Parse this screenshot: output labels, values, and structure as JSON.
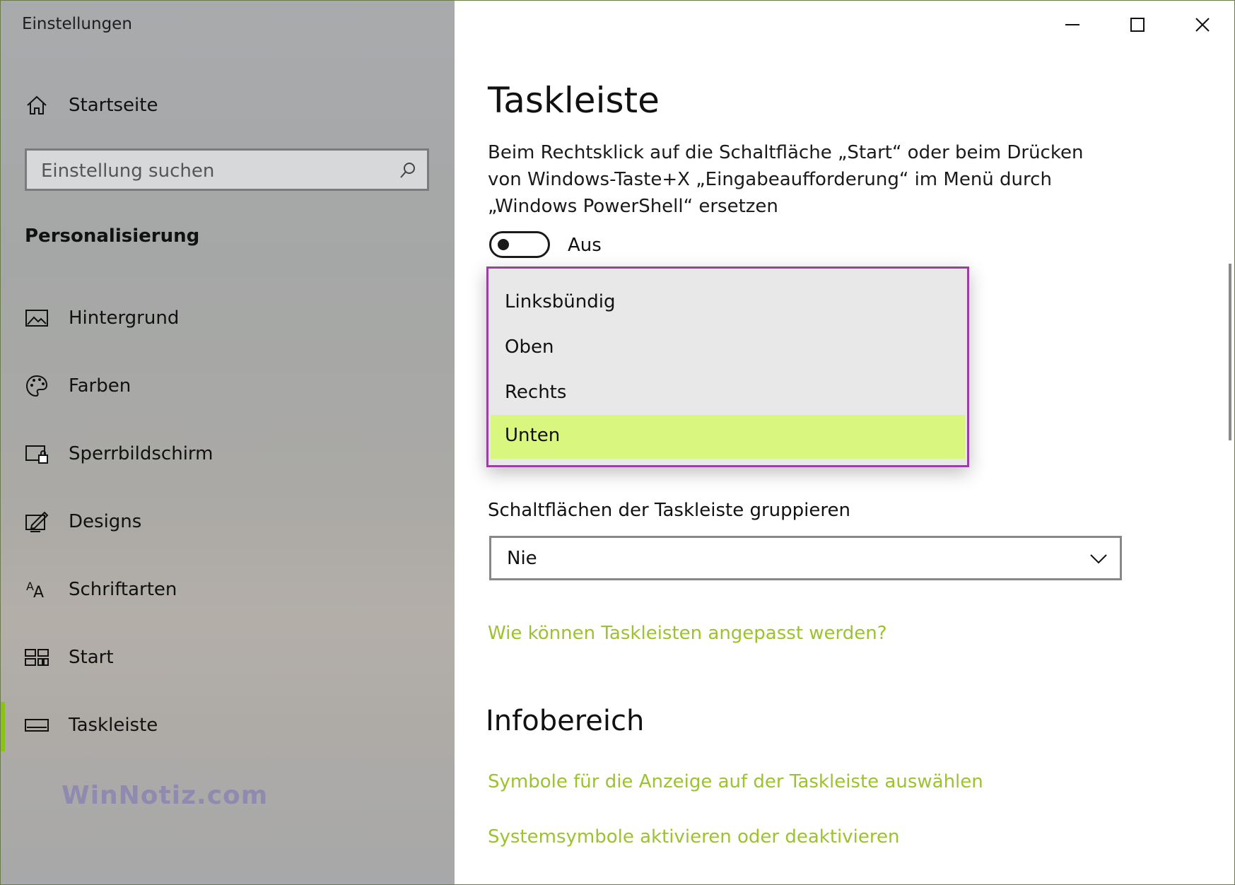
{
  "app": {
    "title": "Einstellungen"
  },
  "sidebar": {
    "home_label": "Startseite",
    "search_placeholder": "Einstellung suchen",
    "section_title": "Personalisierung",
    "items": [
      {
        "label": "Hintergrund",
        "icon": "image-icon"
      },
      {
        "label": "Farben",
        "icon": "palette-icon"
      },
      {
        "label": "Sperrbildschirm",
        "icon": "lock-screen-icon"
      },
      {
        "label": "Designs",
        "icon": "designs-icon"
      },
      {
        "label": "Schriftarten",
        "icon": "fonts-icon"
      },
      {
        "label": "Start",
        "icon": "start-icon"
      },
      {
        "label": "Taskleiste",
        "icon": "taskbar-icon",
        "active": true
      }
    ],
    "watermark": "WinNotiz.com"
  },
  "main": {
    "title": "Taskleiste",
    "description": "Beim Rechtsklick auf die Schaltfläche „Start“ oder beim Drücken von Windows-Taste+X „Eingabeaufforderung“ im Menü durch „Windows PowerShell“ ersetzen",
    "toggle_state": "Aus",
    "position_options": [
      "Linksbündig",
      "Oben",
      "Rechts",
      "Unten"
    ],
    "position_selected": "Unten",
    "group_label": "Schaltflächen der Taskleiste gruppieren",
    "group_value": "Nie",
    "help_link": "Wie können Taskleisten angepasst werden?",
    "info_title": "Infobereich",
    "info_links": [
      "Symbole für die Anzeige auf der Taskleiste auswählen",
      "Systemsymbole aktivieren oder deaktivieren"
    ]
  },
  "colors": {
    "accent": "#8ac318",
    "link": "#9cc22f",
    "selected_item": "#d9f77f",
    "highlight_border": "#9a3fa3"
  }
}
